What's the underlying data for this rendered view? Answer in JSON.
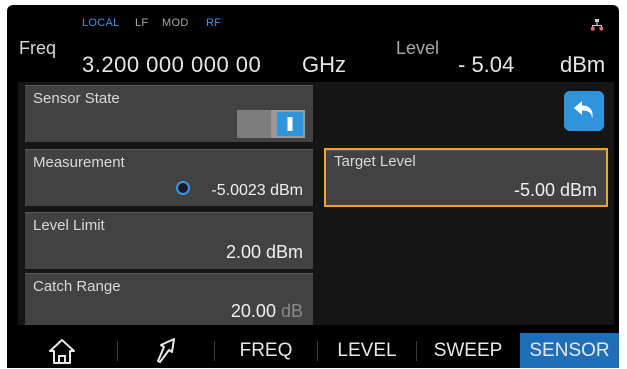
{
  "status": {
    "local": "LOCAL",
    "lf": "LF",
    "mod": "MOD",
    "rf": "RF"
  },
  "colors": {
    "active_blue": "#1f6fb8",
    "status_blue": "#3a97e8",
    "status_gray": "#a9a9a9",
    "target_border": "#f0a22c",
    "card_bg": "#424242"
  },
  "freq": {
    "label": "Freq",
    "value": "3.200 000 000 00",
    "unit": "GHz"
  },
  "level": {
    "label": "Level",
    "value": "- 5.04",
    "unit": "dBm"
  },
  "cards": {
    "sensor_state": {
      "title": "Sensor State",
      "toggle": "on"
    },
    "measurement": {
      "title": "Measurement",
      "value": "-5.0023 dBm"
    },
    "level_limit": {
      "title": "Level Limit",
      "value": "2.00 dBm"
    },
    "catch_range": {
      "title": "Catch Range",
      "value": "20.00",
      "unit": "dB"
    },
    "target_level": {
      "title": "Target Level",
      "value": "-5.00 dBm"
    }
  },
  "icons": {
    "network": "network-icon",
    "back": "back-arrow-icon",
    "home": "home-icon",
    "arrow": "diagonal-arrow-icon"
  },
  "nav": {
    "freq": "FREQ",
    "level": "LEVEL",
    "sweep": "SWEEP",
    "sensor": "SENSOR"
  }
}
